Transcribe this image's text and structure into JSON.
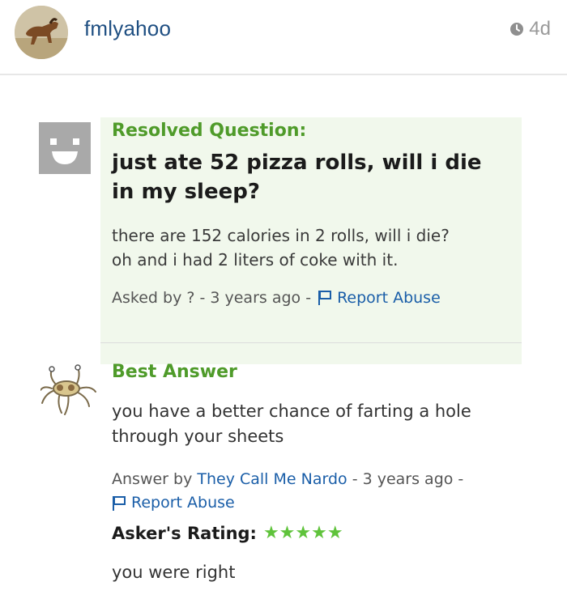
{
  "header": {
    "username": "fmlyahoo",
    "time": "4d"
  },
  "question": {
    "status_label": "Resolved Question:",
    "title": "just ate 52 pizza rolls, will i die in my sleep?",
    "body_line1": "there are 152 calories in 2 rolls, will i die?",
    "body_line2": "oh and i had 2 liters of coke with it.",
    "asked_by": "Asked by ? - 3 years ago -",
    "report_label": "Report Abuse"
  },
  "answer": {
    "label": "Best Answer",
    "body_line1": "you have a better chance of farting a hole",
    "body_line2": "through your sheets",
    "answer_by_prefix": "Answer by ",
    "answerer": "They Call Me Nardo",
    "answer_by_suffix": " - 3 years ago -",
    "report_label": "Report Abuse",
    "rating_label": "Asker's Rating:",
    "stars": "★★★★★",
    "comment": "you were right"
  },
  "colors": {
    "green_label": "#4f9b2a",
    "link_blue": "#1a5ea8",
    "username_blue": "#1f4f82",
    "question_bg": "#f1f8ec",
    "star_green": "#5fc33b"
  },
  "icons": {
    "profile": "horse-avatar",
    "time": "clock-icon",
    "asker": "smiley-avatar",
    "answerer": "spaghetti-monster-avatar",
    "report": "flag-icon"
  }
}
